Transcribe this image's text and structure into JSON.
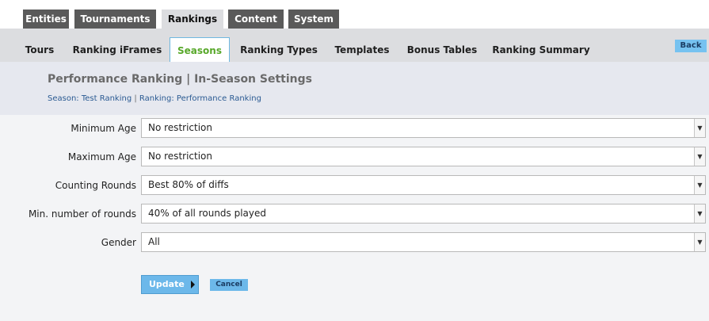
{
  "top_tabs": [
    "Entities",
    "Tournaments",
    "Rankings",
    "Content",
    "System"
  ],
  "top_tabs_active": "Rankings",
  "sub_tabs": [
    "Tours",
    "Ranking iFrames",
    "Seasons",
    "Ranking Types",
    "Templates",
    "Bonus Tables",
    "Ranking Summary"
  ],
  "sub_tabs_active": "Seasons",
  "back_label": "Back",
  "page": {
    "title": "Performance Ranking | In-Season Settings",
    "season_link": "Season: Test Ranking",
    "separator": "|",
    "ranking_link": "Ranking: Performance Ranking"
  },
  "form": {
    "fields": [
      {
        "label": "Minimum Age",
        "value": "No restriction"
      },
      {
        "label": "Maximum Age",
        "value": "No restriction"
      },
      {
        "label": "Counting Rounds",
        "value": "Best 80% of diffs"
      },
      {
        "label": "Min. number of rounds",
        "value": "40% of all rounds played"
      },
      {
        "label": "Gender",
        "value": "All"
      }
    ],
    "update_label": "Update",
    "cancel_label": "Cancel"
  },
  "colors": {
    "accent_blue": "#6cb8ea",
    "active_green": "#58a82a",
    "dark_tab": "#5a5a5a"
  },
  "icons": {
    "dropdown": "caret-down-icon",
    "update": "play-icon"
  }
}
